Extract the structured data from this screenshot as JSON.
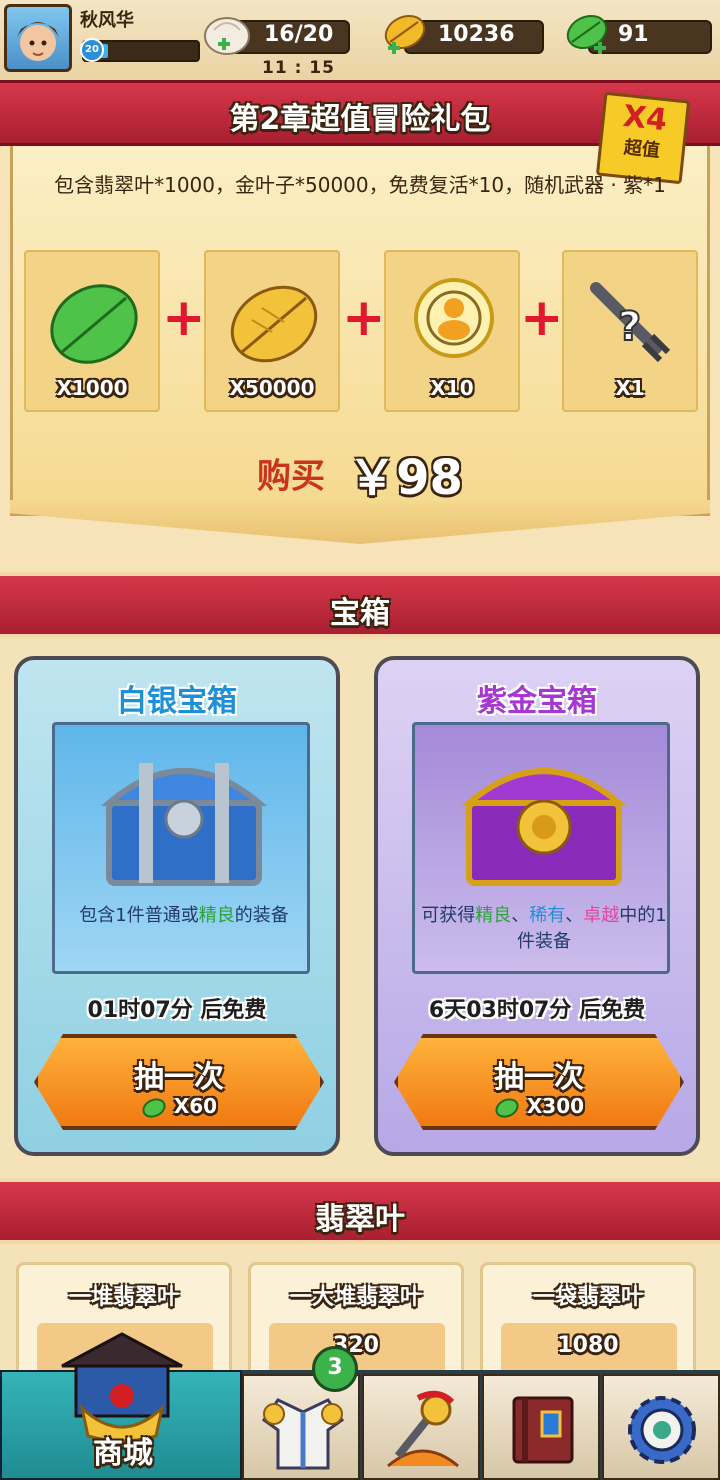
{
  "player": {
    "name": "秋风华",
    "level": "20",
    "xp_fraction": 0.2
  },
  "resources": {
    "stamina": "16/20",
    "gold_leaf": "10236",
    "jade_leaf": "91",
    "timer": "11 : 15"
  },
  "bundle": {
    "title": "第2章超值冒险礼包",
    "badge_big": "X4",
    "badge_small": "超值",
    "description": "包含翡翠叶*1000，金叶子*50000，免费复活*10，随机武器 · 紫*1",
    "items": [
      {
        "icon": "jade-leaf-icon",
        "qty": "X1000"
      },
      {
        "icon": "gold-leaf-icon",
        "qty": "X50000"
      },
      {
        "icon": "revive-icon",
        "qty": "X10"
      },
      {
        "icon": "mystery-weapon-icon",
        "qty": "X1"
      }
    ],
    "buy_label": "购买",
    "price": "￥98"
  },
  "chest_section": {
    "title": "宝箱"
  },
  "chests": {
    "silver": {
      "title": "白银宝箱",
      "desc_pre": "包含1件普通或",
      "desc_hl": "精良",
      "desc_post": "的装备",
      "timer": "01时07分 后免费",
      "button": "抽一次",
      "cost": "X60"
    },
    "gold": {
      "title": "紫金宝箱",
      "desc_pre": "可获得",
      "desc_hl1": "精良",
      "desc_sep1": "、",
      "desc_hl2": "稀有",
      "desc_sep2": "、",
      "desc_hl3": "卓越",
      "desc_post": "中的1件装备",
      "timer": "6天03时07分 后免费",
      "button": "抽一次",
      "cost": "X300"
    }
  },
  "jade_section": {
    "title": "翡翠叶"
  },
  "jade_packs": [
    {
      "name": "一堆翡翠叶",
      "amount": ""
    },
    {
      "name": "一大堆翡翠叶",
      "amount": "320"
    },
    {
      "name": "一袋翡翠叶",
      "amount": "1080"
    }
  ],
  "nav": {
    "shop_label": "商城",
    "badge_count": "3"
  },
  "colors": {
    "banner_red": "#c42c3e",
    "accent_orange": "#f07a12",
    "jade_green": "#3fbf4a",
    "purple_title": "#a638d0",
    "rare_pink": "#e0489c"
  }
}
